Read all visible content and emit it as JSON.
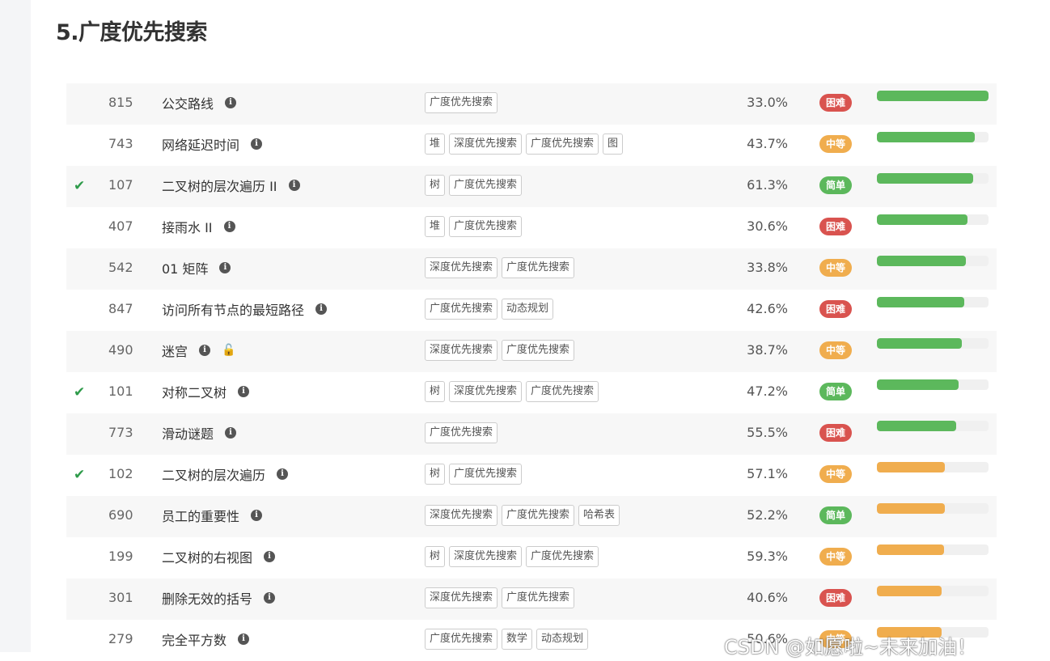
{
  "page": {
    "title": "5.广度优先搜索"
  },
  "problems": [
    {
      "solved": false,
      "id": "815",
      "title": "公交路线",
      "locked": false,
      "tags": [
        "广度优先搜索"
      ],
      "acceptance": "33.0%",
      "difficulty": "困难",
      "difficulty_level": "hard",
      "frequency": 1.0,
      "bar_color": "green"
    },
    {
      "solved": false,
      "id": "743",
      "title": "网络延迟时间",
      "locked": false,
      "tags": [
        "堆",
        "深度优先搜索",
        "广度优先搜索",
        "图"
      ],
      "acceptance": "43.7%",
      "difficulty": "中等",
      "difficulty_level": "medium",
      "frequency": 0.88,
      "bar_color": "green"
    },
    {
      "solved": true,
      "id": "107",
      "title": "二叉树的层次遍历 II",
      "locked": false,
      "tags": [
        "树",
        "广度优先搜索"
      ],
      "acceptance": "61.3%",
      "difficulty": "简单",
      "difficulty_level": "easy",
      "frequency": 0.86,
      "bar_color": "green"
    },
    {
      "solved": false,
      "id": "407",
      "title": "接雨水 II",
      "locked": false,
      "tags": [
        "堆",
        "广度优先搜索"
      ],
      "acceptance": "30.6%",
      "difficulty": "困难",
      "difficulty_level": "hard",
      "frequency": 0.81,
      "bar_color": "green"
    },
    {
      "solved": false,
      "id": "542",
      "title": "01 矩阵",
      "locked": false,
      "tags": [
        "深度优先搜索",
        "广度优先搜索"
      ],
      "acceptance": "33.8%",
      "difficulty": "中等",
      "difficulty_level": "medium",
      "frequency": 0.8,
      "bar_color": "green"
    },
    {
      "solved": false,
      "id": "847",
      "title": "访问所有节点的最短路径",
      "locked": false,
      "tags": [
        "广度优先搜索",
        "动态规划"
      ],
      "acceptance": "42.6%",
      "difficulty": "困难",
      "difficulty_level": "hard",
      "frequency": 0.78,
      "bar_color": "green"
    },
    {
      "solved": false,
      "id": "490",
      "title": "迷宫",
      "locked": true,
      "tags": [
        "深度优先搜索",
        "广度优先搜索"
      ],
      "acceptance": "38.7%",
      "difficulty": "中等",
      "difficulty_level": "medium",
      "frequency": 0.76,
      "bar_color": "green"
    },
    {
      "solved": true,
      "id": "101",
      "title": "对称二叉树",
      "locked": false,
      "tags": [
        "树",
        "深度优先搜索",
        "广度优先搜索"
      ],
      "acceptance": "47.2%",
      "difficulty": "简单",
      "difficulty_level": "easy",
      "frequency": 0.73,
      "bar_color": "green"
    },
    {
      "solved": false,
      "id": "773",
      "title": "滑动谜题",
      "locked": false,
      "tags": [
        "广度优先搜索"
      ],
      "acceptance": "55.5%",
      "difficulty": "困难",
      "difficulty_level": "hard",
      "frequency": 0.71,
      "bar_color": "green"
    },
    {
      "solved": true,
      "id": "102",
      "title": "二叉树的层次遍历",
      "locked": false,
      "tags": [
        "树",
        "广度优先搜索"
      ],
      "acceptance": "57.1%",
      "difficulty": "中等",
      "difficulty_level": "medium",
      "frequency": 0.61,
      "bar_color": "orange"
    },
    {
      "solved": false,
      "id": "690",
      "title": "员工的重要性",
      "locked": false,
      "tags": [
        "深度优先搜索",
        "广度优先搜索",
        "哈希表"
      ],
      "acceptance": "52.2%",
      "difficulty": "简单",
      "difficulty_level": "easy",
      "frequency": 0.61,
      "bar_color": "orange"
    },
    {
      "solved": false,
      "id": "199",
      "title": "二叉树的右视图",
      "locked": false,
      "tags": [
        "树",
        "深度优先搜索",
        "广度优先搜索"
      ],
      "acceptance": "59.3%",
      "difficulty": "中等",
      "difficulty_level": "medium",
      "frequency": 0.6,
      "bar_color": "orange"
    },
    {
      "solved": false,
      "id": "301",
      "title": "删除无效的括号",
      "locked": false,
      "tags": [
        "深度优先搜索",
        "广度优先搜索"
      ],
      "acceptance": "40.6%",
      "difficulty": "困难",
      "difficulty_level": "hard",
      "frequency": 0.58,
      "bar_color": "orange"
    },
    {
      "solved": false,
      "id": "279",
      "title": "完全平方数",
      "locked": false,
      "tags": [
        "广度优先搜索",
        "数学",
        "动态规划"
      ],
      "acceptance": "50.6%",
      "difficulty": "中等",
      "difficulty_level": "medium",
      "frequency": 0.58,
      "bar_color": "orange"
    }
  ],
  "watermark": "CSDN @如愿啦~未来加油！",
  "colors": {
    "hard": "#d9534f",
    "medium": "#f0ad4e",
    "easy": "#5cb85c",
    "check": "#2e9b4a"
  }
}
